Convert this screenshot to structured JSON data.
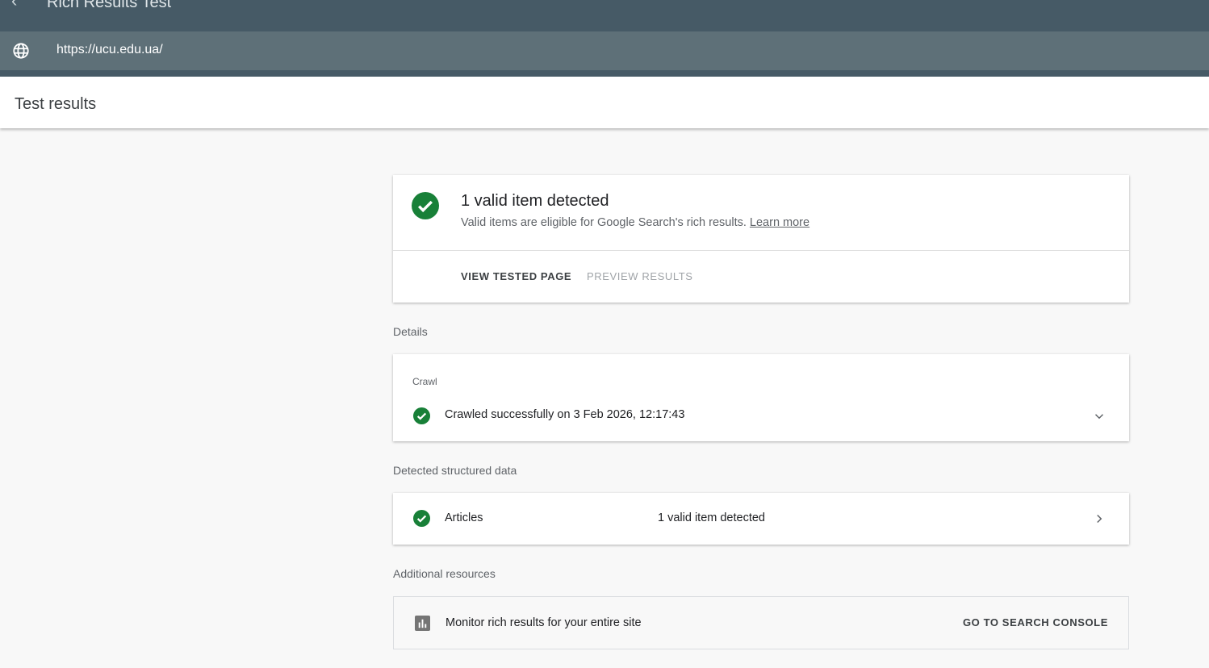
{
  "app": {
    "title": "Rich Results Test",
    "url": "https://ucu.edu.ua/"
  },
  "results_title": "Test results",
  "summary": {
    "title": "1 valid item detected",
    "subtitle": "Valid items are eligible for Google Search's rich results.",
    "learn_more": "Learn more",
    "view_tested_page": "VIEW TESTED PAGE",
    "preview_results": "PREVIEW RESULTS"
  },
  "details": {
    "heading": "Details",
    "crawl_label": "Crawl",
    "crawl_status": "Crawled successfully on 3 Feb 2026, 12:17:43"
  },
  "structured": {
    "heading": "Detected structured data",
    "items": [
      {
        "name": "Articles",
        "status": "1 valid item detected"
      }
    ]
  },
  "resources": {
    "heading": "Additional resources",
    "text": "Monitor rich results for your entire site",
    "button": "GO TO SEARCH CONSOLE"
  },
  "colors": {
    "success": "#188038",
    "header": "#465a66",
    "urlbar": "#5e7078"
  }
}
